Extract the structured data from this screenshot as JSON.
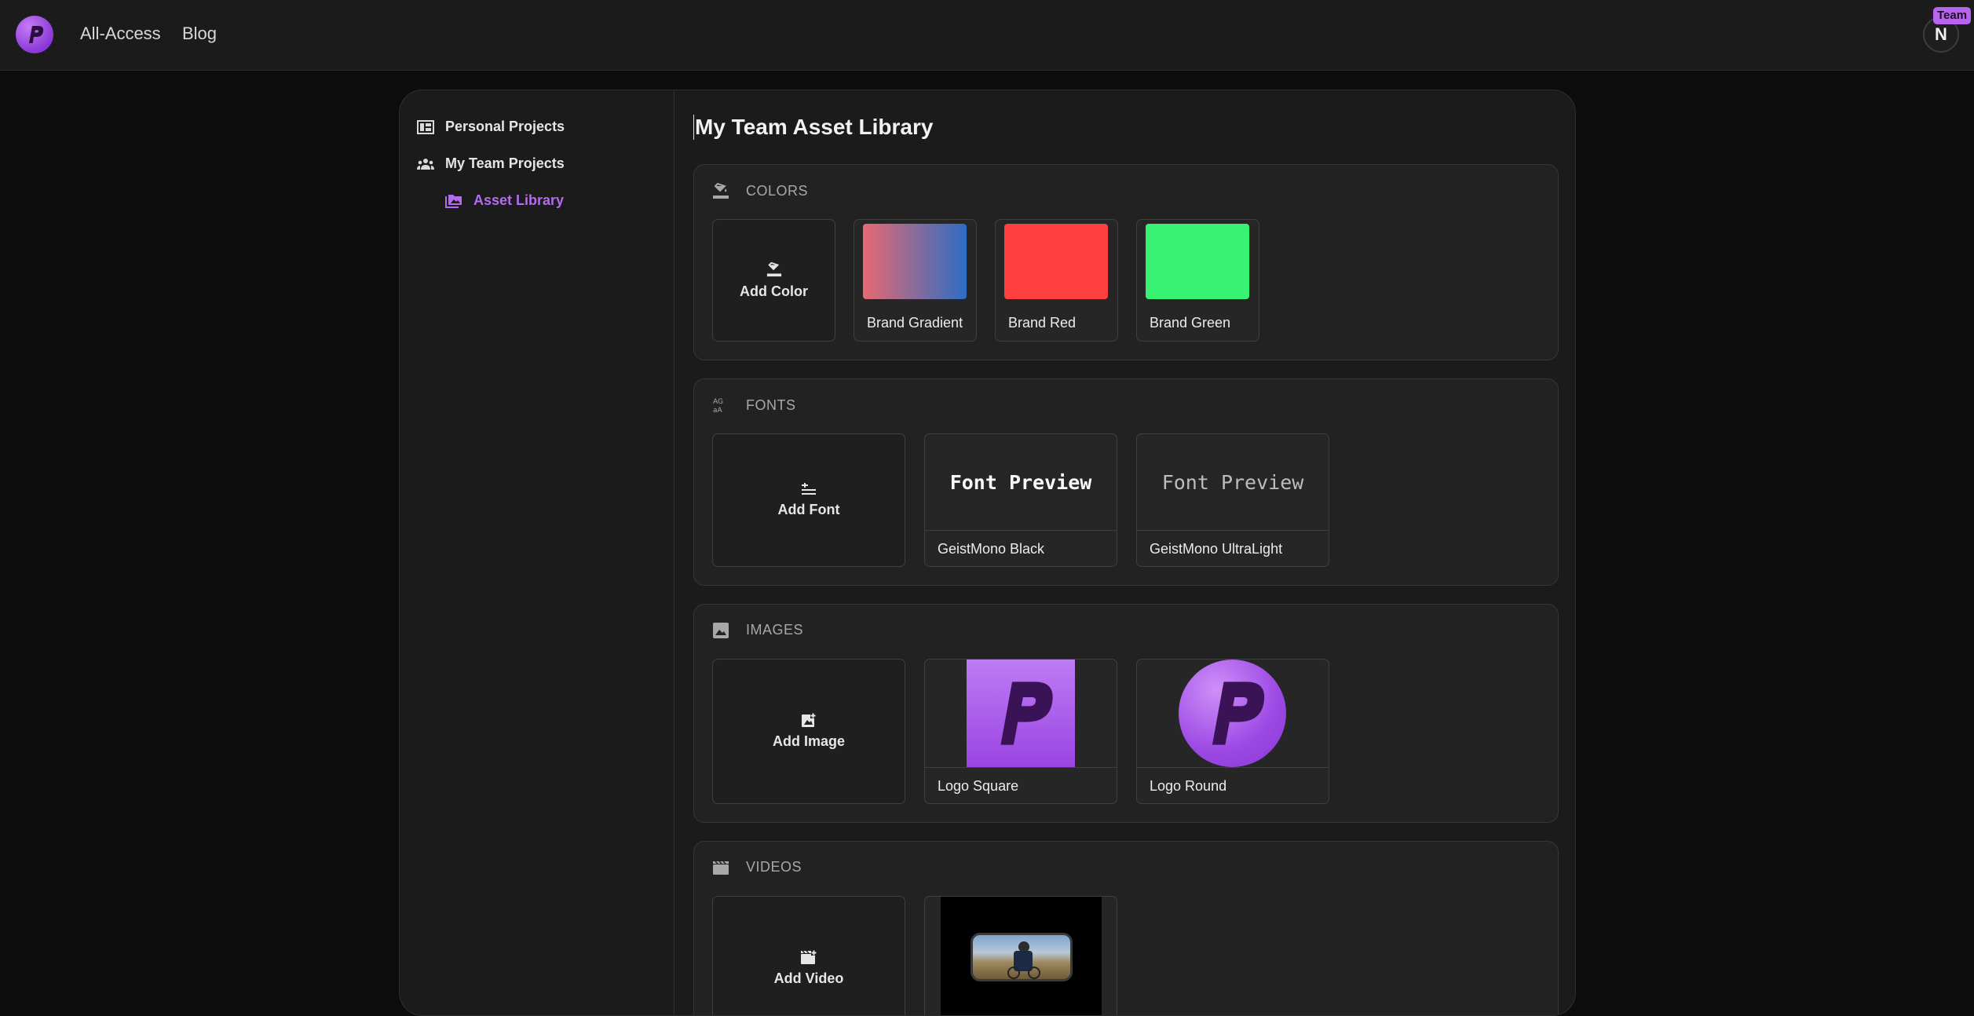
{
  "topbar": {
    "nav": [
      "All-Access",
      "Blog"
    ],
    "avatar_initial": "N",
    "team_badge": "Team"
  },
  "sidebar": {
    "items": [
      {
        "label": "Personal Projects",
        "icon": "dashboard-icon"
      },
      {
        "label": "My Team Projects",
        "icon": "group-icon"
      },
      {
        "label": "Asset Library",
        "icon": "folder-image-icon",
        "active": true
      }
    ]
  },
  "main": {
    "title": "My Team Asset Library",
    "colors": {
      "title": "COLORS",
      "add_label": "Add Color",
      "items": [
        {
          "label": "Brand Gradient",
          "swatch": "linear-gradient(90deg,#e76a72,#2d6cc4)"
        },
        {
          "label": "Brand Red",
          "swatch": "#fe4040"
        },
        {
          "label": "Brand Green",
          "swatch": "#38f274"
        }
      ]
    },
    "fonts": {
      "title": "FONTS",
      "add_label": "Add Font",
      "preview_text": "Font Preview",
      "items": [
        {
          "label": "GeistMono Black"
        },
        {
          "label": "GeistMono UltraLight"
        }
      ]
    },
    "images": {
      "title": "IMAGES",
      "add_label": "Add Image",
      "items": [
        {
          "label": "Logo Square"
        },
        {
          "label": "Logo Round"
        }
      ]
    },
    "videos": {
      "title": "VIDEOS",
      "add_label": "Add Video"
    }
  },
  "colors": {
    "accent": "#b36cf0",
    "background": "#0c0c0c",
    "panel": "#1b1b1b"
  }
}
